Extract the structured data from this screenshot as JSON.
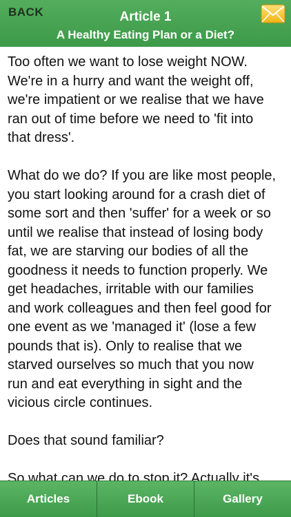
{
  "header": {
    "back_label": "BACK",
    "title": "Article 1",
    "subtitle": "A Healthy Eating Plan or a Diet?",
    "mail_icon": "envelope-icon"
  },
  "article": {
    "text": "Too often we want to lose weight NOW.\nWe're in a hurry and want the weight off,\nwe're impatient or we realise that we have\nran out of time before we need to 'fit into\nthat dress'.\n\nWhat do we do? If you are like most people,\nyou start looking around for a crash diet of\nsome sort and then 'suffer' for a week or so\nuntil we realise that instead of losing body\nfat, we are starving our bodies of all the\ngoodness it needs to function properly. We\nget headaches, irritable with our families\nand work colleagues and then feel good for\none event as we 'managed it' (lose a few\npounds that is). Only to realise that we\nstarved ourselves so much that you now\nrun and eat everything in sight and the\nvicious circle continues.\n\nDoes that sound familiar?\n\nSo what can we do to stop it? Actually it's"
  },
  "tabs": [
    {
      "label": "Articles"
    },
    {
      "label": "Ebook"
    },
    {
      "label": "Gallery"
    }
  ],
  "colors": {
    "header_green": "#46a352",
    "tab_green": "#4aa955",
    "mail_yellow": "#f2c21a"
  }
}
